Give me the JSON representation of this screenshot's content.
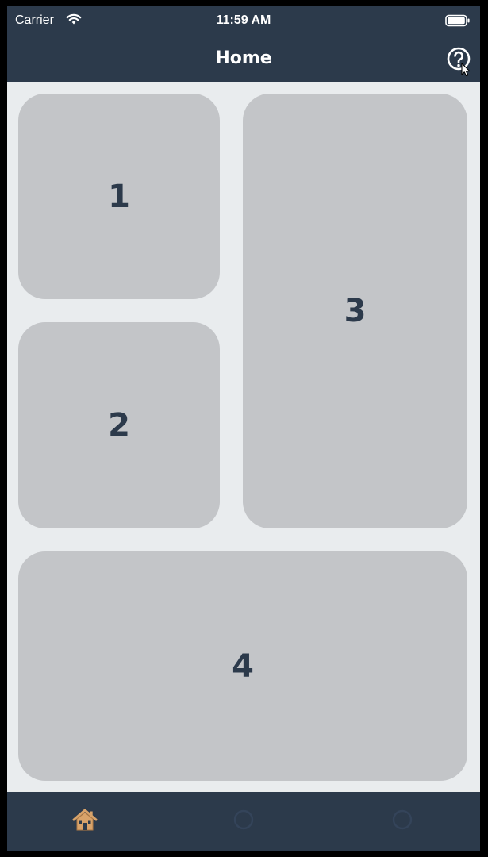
{
  "status_bar": {
    "carrier": "Carrier",
    "time": "11:59 AM",
    "wifi_icon": "wifi-icon",
    "battery_icon": "battery-icon"
  },
  "nav_bar": {
    "title": "Home",
    "help_icon": "question-circle-icon"
  },
  "tiles": [
    {
      "label": "1"
    },
    {
      "label": "2"
    },
    {
      "label": "3"
    },
    {
      "label": "4"
    }
  ],
  "tab_bar": {
    "tabs": [
      {
        "icon": "home-icon",
        "selected": true
      },
      {
        "icon": "tab-2-icon",
        "selected": false
      },
      {
        "icon": "tab-3-icon",
        "selected": false
      }
    ]
  },
  "colors": {
    "bar_background": "#2c3a4b",
    "content_background": "#e9ecee",
    "tile_background": "#c3c5c8",
    "tile_text": "#2c3a4b",
    "home_icon_accent": "#d8a36a"
  }
}
